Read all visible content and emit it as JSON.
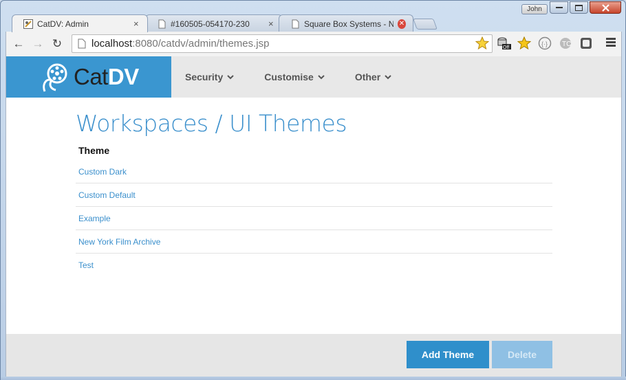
{
  "window": {
    "user_badge": "John",
    "controls": [
      "minimize",
      "maximize",
      "close"
    ]
  },
  "tabs": [
    {
      "title": "CatDV: Admin",
      "close": "×",
      "active": true
    },
    {
      "title": "#160505-054170-230",
      "close": "×",
      "active": false
    },
    {
      "title": "Square Box Systems - New",
      "close": "✕",
      "active": false
    }
  ],
  "toolbar": {
    "url_host": "localhost",
    "url_path": ":8080/catdv/admin/themes.jsp",
    "back_icon": "←",
    "forward_icon": "→",
    "reload_icon": "↻"
  },
  "navbar": {
    "brand_plain": "Cat",
    "brand_bold": "DV",
    "items": [
      {
        "label": "Security"
      },
      {
        "label": "Customise"
      },
      {
        "label": "Other"
      }
    ]
  },
  "main": {
    "title": "Workspaces / UI Themes",
    "column_header": "Theme",
    "themes": [
      "Custom Dark",
      "Custom Default",
      "Example",
      "New York Film Archive",
      "Test"
    ]
  },
  "footer": {
    "add_label": "Add Theme",
    "delete_label": "Delete"
  },
  "colors": {
    "accent": "#3a96d0",
    "link": "#3a8fcc",
    "button": "#2f8fcb",
    "button_disabled": "#8fc0e4"
  }
}
